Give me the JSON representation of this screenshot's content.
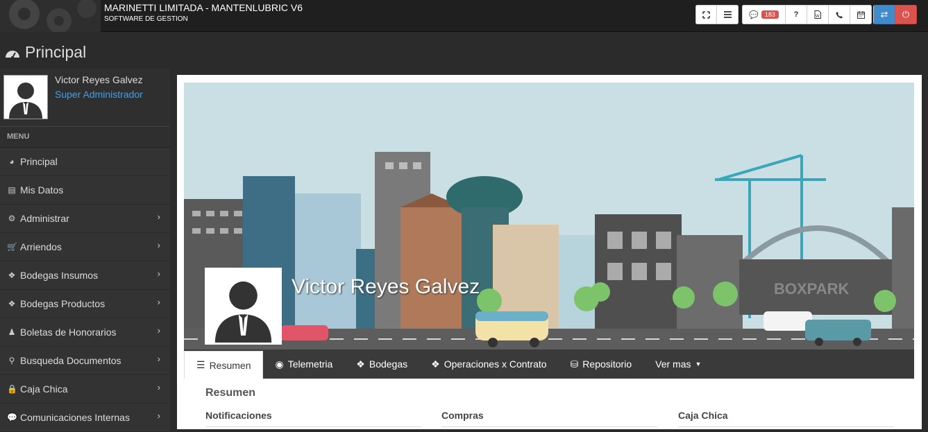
{
  "app": {
    "title": "MARINETTI LIMITADA - MANTENLUBRIC V6",
    "subtitle": "SOFTWARE DE GESTION"
  },
  "toolbar": {
    "messages_count": "183",
    "help_label": "?"
  },
  "page": {
    "title": "Principal"
  },
  "user": {
    "name": "Victor Reyes Galvez",
    "role": "Super Administrador"
  },
  "menu": {
    "heading": "MENU",
    "items": [
      {
        "label": "Principal",
        "icon": "dashboard-icon",
        "has_submenu": false
      },
      {
        "label": "Mis Datos",
        "icon": "id-card-icon",
        "has_submenu": false
      },
      {
        "label": "Administrar",
        "icon": "gear-icon",
        "has_submenu": true
      },
      {
        "label": "Arriendos",
        "icon": "cart-icon",
        "has_submenu": true
      },
      {
        "label": "Bodegas Insumos",
        "icon": "cubes-icon",
        "has_submenu": true
      },
      {
        "label": "Bodegas Productos",
        "icon": "cubes-icon",
        "has_submenu": true
      },
      {
        "label": "Boletas de Honorarios",
        "icon": "user-icon",
        "has_submenu": true
      },
      {
        "label": "Busqueda Documentos",
        "icon": "search-icon",
        "has_submenu": true
      },
      {
        "label": "Caja Chica",
        "icon": "lock-icon",
        "has_submenu": true
      },
      {
        "label": "Comunicaciones Internas",
        "icon": "comment-icon",
        "has_submenu": true
      }
    ]
  },
  "banner": {
    "profile_name": "Victor Reyes Galvez",
    "sign_text": "BOXPARK"
  },
  "tabs": [
    {
      "label": "Resumen",
      "icon": "list-icon",
      "active": true
    },
    {
      "label": "Telemetria",
      "icon": "target-icon",
      "active": false
    },
    {
      "label": "Bodegas",
      "icon": "cubes-icon",
      "active": false
    },
    {
      "label": "Operaciones x Contrato",
      "icon": "cubes-icon",
      "active": false
    },
    {
      "label": "Repositorio",
      "icon": "database-icon",
      "active": false
    },
    {
      "label": "Ver mas",
      "icon": "caret-down-icon",
      "active": false
    }
  ],
  "summary": {
    "title": "Resumen",
    "columns": [
      "Notificaciones",
      "Compras",
      "Caja Chica"
    ]
  },
  "colors": {
    "accent_blue": "#428bca",
    "danger_red": "#d9534f",
    "role_blue": "#4a9fe0"
  }
}
